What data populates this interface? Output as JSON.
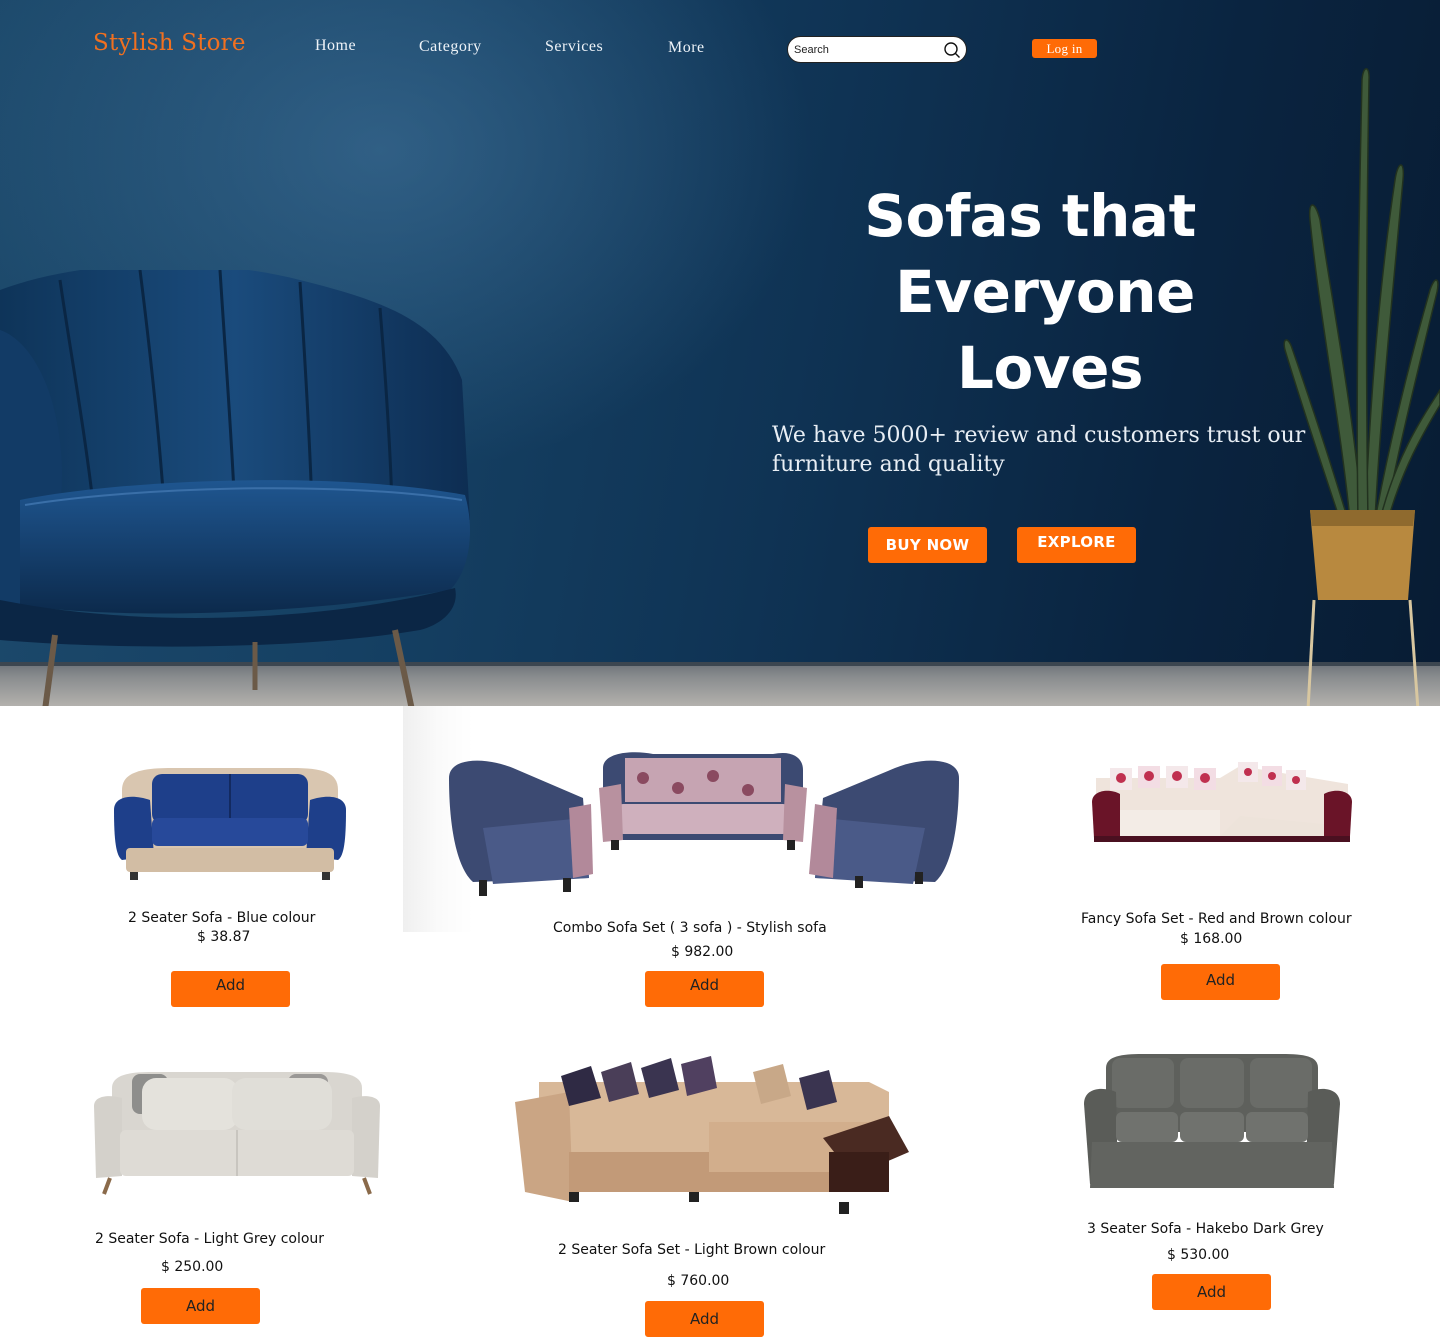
{
  "brand": "Stylish Store",
  "nav": [
    "Home",
    "Category",
    "Services",
    "More"
  ],
  "search": {
    "placeholder": "Search"
  },
  "login_label": "Log in",
  "hero": {
    "title_lines": [
      "Sofas that",
      "Everyone",
      "Loves"
    ],
    "subtitle_lines": [
      "We have 5000+ review and customers trust our",
      "furniture and quality"
    ],
    "buy_label": "BUY NOW",
    "explore_label": "EXPLORE"
  },
  "colors": {
    "accent": "#ff6b06",
    "hero_dark": "#0f3354"
  },
  "products": [
    {
      "name": "2 Seater Sofa - Blue colour",
      "price": "$ 38.87",
      "add_label": "Add"
    },
    {
      "name": "Combo Sofa Set ( 3 sofa ) - Stylish sofa",
      "price": "$ 982.00",
      "add_label": "Add"
    },
    {
      "name": "Fancy Sofa Set - Red and Brown colour",
      "price": "$ 168.00",
      "add_label": "Add"
    },
    {
      "name": "2 Seater Sofa - Light Grey colour",
      "price": "$ 250.00",
      "add_label": "Add"
    },
    {
      "name": "2 Seater Sofa Set - Light Brown colour",
      "price": "$ 760.00",
      "add_label": "Add"
    },
    {
      "name": "3 Seater Sofa - Hakebo Dark Grey",
      "price": "$ 530.00",
      "add_label": "Add"
    }
  ]
}
